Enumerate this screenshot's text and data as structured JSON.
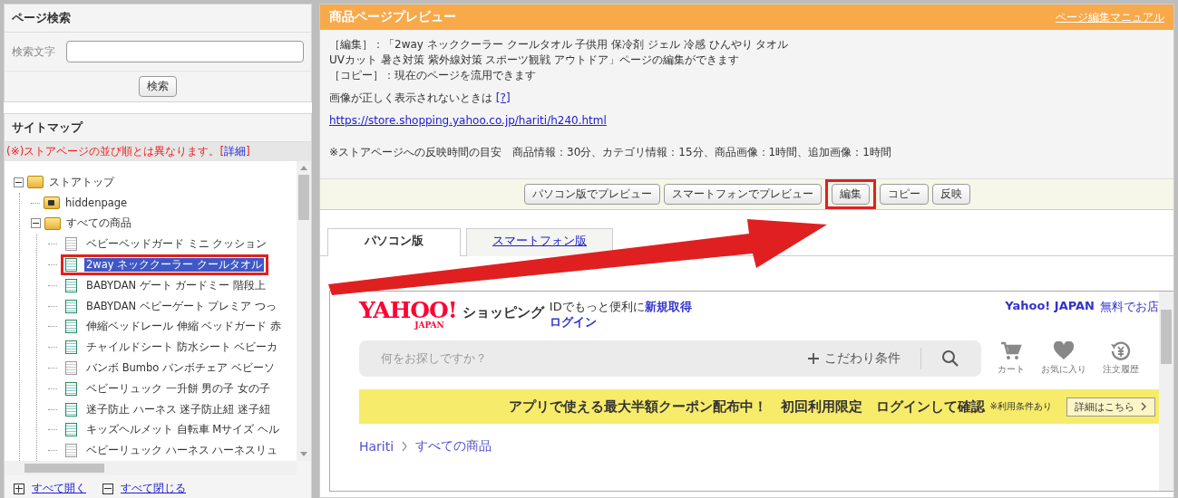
{
  "page_search": {
    "title": "ページ検索",
    "field_label": "検索文字",
    "button": "検索"
  },
  "sitemap": {
    "title": "サイトマップ",
    "notice": "(※)ストアページの並び順とは異なります。[",
    "notice_link": "詳細",
    "notice_end": "]",
    "tree": [
      {
        "label": "ストアトップ",
        "kind": "folder",
        "expanded": true,
        "children": [
          {
            "label": "hiddenpage",
            "kind": "locked-folder"
          },
          {
            "label": "すべての商品",
            "kind": "folder",
            "expanded": true,
            "children": [
              {
                "label": "ベビーベッドガード ミニ クッション",
                "kind": "page",
                "published": false,
                "selected": false,
                "highlighted": false
              },
              {
                "label": "2way ネッククーラー クールタオル",
                "kind": "page",
                "published": true,
                "selected": true,
                "highlighted": true
              },
              {
                "label": "BABYDAN ゲート ガードミー 階段上",
                "kind": "page",
                "published": true,
                "selected": false,
                "highlighted": false
              },
              {
                "label": "BABYDAN ベビーゲート プレミア つっ",
                "kind": "page",
                "published": true,
                "selected": false,
                "highlighted": false
              },
              {
                "label": "伸縮ベッドレール 伸縮 ベッドガード 赤",
                "kind": "page",
                "published": true,
                "selected": false,
                "highlighted": false
              },
              {
                "label": "チャイルドシート 防水シート ベビーカ",
                "kind": "page",
                "published": true,
                "selected": false,
                "highlighted": false
              },
              {
                "label": "バンボ Bumbo バンボチェア ベビーソ",
                "kind": "page",
                "published": false,
                "selected": false,
                "highlighted": false
              },
              {
                "label": "ベビーリュック 一升餅 男の子 女の子",
                "kind": "page",
                "published": true,
                "selected": false,
                "highlighted": false
              },
              {
                "label": "迷子防止 ハーネス 迷子防止紐 迷子紐",
                "kind": "page",
                "published": true,
                "selected": false,
                "highlighted": false
              },
              {
                "label": "キッズヘルメット 自転車 Mサイズ ヘル",
                "kind": "page",
                "published": true,
                "selected": false,
                "highlighted": false
              },
              {
                "label": "ベビーリュック ハーネス ハーネスリュ",
                "kind": "page",
                "published": false,
                "selected": false,
                "highlighted": false
              }
            ]
          }
        ]
      }
    ],
    "expand_all": "すべて開く",
    "collapse_all": "すべて閉じる"
  },
  "preview": {
    "title": "商品ページプレビュー",
    "manual_link": "ページ編集マニュアル",
    "edit_note": "［編集］：「2way ネッククーラー クールタオル 子供用 保冷剤 ジェル 冷感 ひんやり タオル UVカット 暑さ対策 紫外線対策 スポーツ観戦 アウトドア」ページの編集ができます",
    "copy_note": "［コピー］：現在のページを流用できます",
    "image_note": "画像が正しく表示されないときは",
    "image_help_link": "[?]",
    "url": "https://store.shopping.yahoo.co.jp/hariti/h240.html",
    "timing_note": "※ストアページへの反映時間の目安　商品情報：30分、カテゴリ情報：15分、商品画像：1時間、追加画像：1時間",
    "buttons": [
      {
        "label": "パソコン版でプレビュー",
        "highlighted": false
      },
      {
        "label": "スマートフォンでプレビュー",
        "highlighted": false
      },
      {
        "label": "編集",
        "highlighted": true
      },
      {
        "label": "コピー",
        "highlighted": false
      },
      {
        "label": "反映",
        "highlighted": false
      }
    ],
    "tabs": [
      {
        "label": "パソコン版",
        "selected": true
      },
      {
        "label": "スマートフォン版",
        "selected": false
      }
    ]
  },
  "store_page": {
    "logo_main": "YAHOO!",
    "logo_sub": "JAPAN",
    "logo_service": "ショッピング",
    "id_prompt": "IDでもっと便利に",
    "signup_link": "新規取得",
    "login_link": "ログイン",
    "portal_link": "Yahoo! JAPAN",
    "open_store_link": "無料でお店",
    "search_placeholder": "何をお探しですか？",
    "filter_button": "こだわり条件",
    "icons": [
      {
        "kind": "cart",
        "label": "カート"
      },
      {
        "kind": "heart",
        "label": "お気に入り"
      },
      {
        "kind": "history",
        "label": "注文履歴"
      }
    ],
    "banner": {
      "text": "アプリで使える最大半額クーポン配布中！　初回利用限定　ログインして確認",
      "note": "※利用条件あり",
      "button": "詳細はこちら"
    },
    "breadcrumb": [
      "Hariti",
      "すべての商品"
    ]
  },
  "annotations": [
    {
      "kind": "arrow"
    }
  ]
}
